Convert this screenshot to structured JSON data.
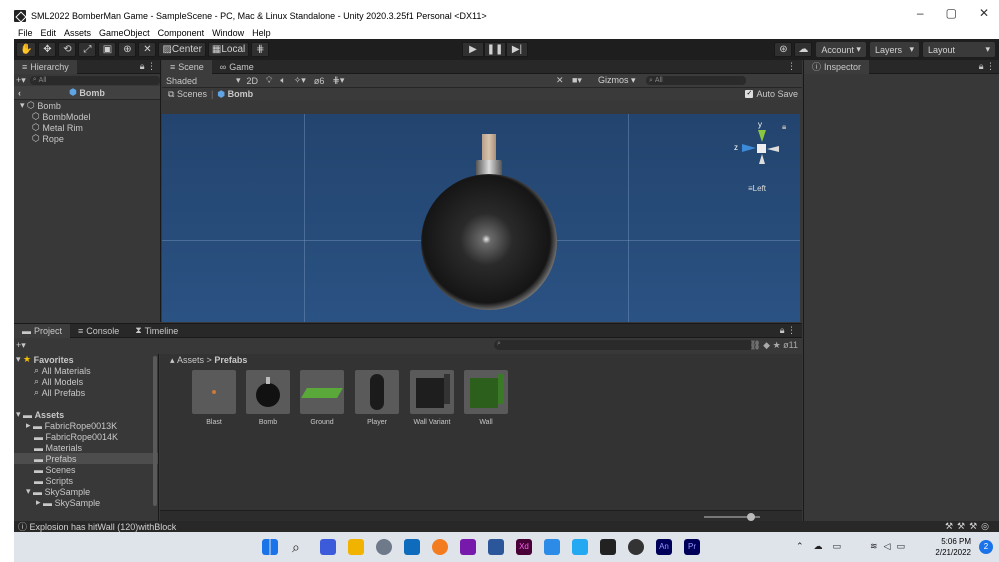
{
  "window": {
    "title": "SML2022 BomberMan Game - SampleScene - PC, Mac & Linux Standalone - Unity 2020.3.25f1 Personal <DX11>",
    "controls": [
      "–",
      "▢",
      "✕"
    ]
  },
  "menu": [
    "File",
    "Edit",
    "Assets",
    "GameObject",
    "Component",
    "Window",
    "Help"
  ],
  "toolbar": {
    "pivot": "Center",
    "space": "Local",
    "account": "Account",
    "layers": "Layers",
    "layout": "Layout"
  },
  "hierarchy": {
    "tab": "Hierarchy",
    "search_placeholder": "All",
    "prefab_title": "Bomb",
    "root": "Bomb",
    "children": [
      "BombModel",
      "Metal Rim",
      "Rope"
    ]
  },
  "scene": {
    "tabs": [
      "Scene",
      "Game"
    ],
    "shading": "Shaded",
    "mode2d": "2D",
    "layer_count": "6",
    "gizmos": "Gizmos",
    "search_placeholder": "All",
    "breadcrumb_scenes": "Scenes",
    "breadcrumb_prefab": "Bomb",
    "auto_save": "Auto Save",
    "gizmo_axis_y": "y",
    "gizmo_axis_z": "z",
    "gizmo_view": "Left"
  },
  "inspector": {
    "tab": "Inspector"
  },
  "project": {
    "tabs": [
      "Project",
      "Console",
      "Timeline"
    ],
    "breadcrumb_root": "Assets",
    "breadcrumb_current": "Prefabs",
    "hidden_count": "11",
    "favorites_label": "Favorites",
    "favorites": [
      "All Materials",
      "All Models",
      "All Prefabs"
    ],
    "assets_label": "Assets",
    "folders": [
      "FabricRope0013K",
      "FabricRope0014K",
      "Materials",
      "Prefabs",
      "Scenes",
      "Scripts",
      "SkySample",
      "SkySample"
    ],
    "selected_folder": "Prefabs",
    "assets": [
      "Blast",
      "Bomb",
      "Ground",
      "Player",
      "Wall Variant",
      "Wall"
    ]
  },
  "status": {
    "message": "Explosion has hitWall (120)withBlock"
  },
  "taskbar": {
    "time": "5:06 PM",
    "date": "2/21/2022",
    "notification_count": "2",
    "app_labels": {
      "xd": "Xd",
      "animate": "An",
      "premiere": "Pr"
    }
  },
  "colors": {
    "viewport": "#2a5283",
    "accent": "#2c5d87",
    "taskbar": "#dfe3ea"
  }
}
